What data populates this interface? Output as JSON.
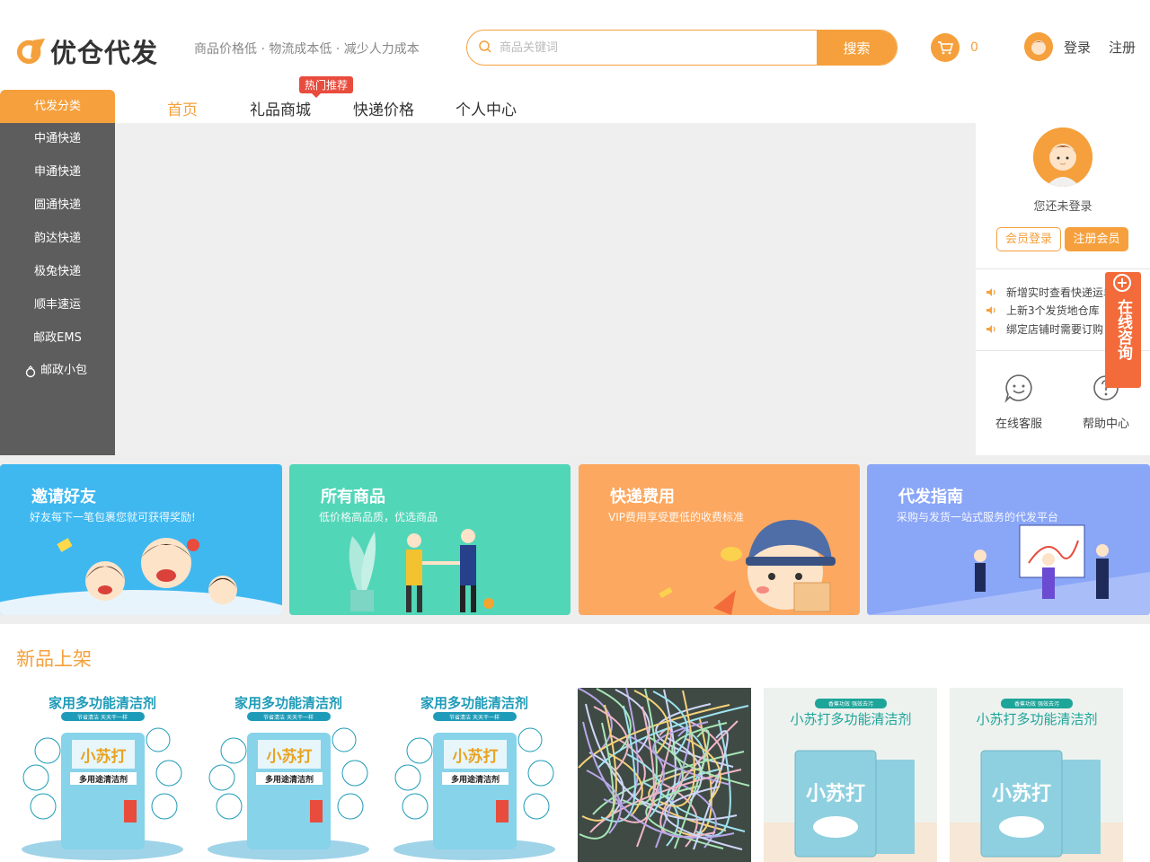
{
  "header": {
    "logo_text": "优仓代发",
    "slogan": "商品价格低 · 物流成本低 · 减少人力成本",
    "search": {
      "placeholder": "商品关键词",
      "button": "搜索"
    },
    "cart_count": "0",
    "login": "登录",
    "register": "注册"
  },
  "category": {
    "header": "代发分类",
    "items": [
      "中通快递",
      "申通快递",
      "圆通快递",
      "韵达快递",
      "极兔快递",
      "顺丰速运",
      "邮政EMS",
      "邮政小包"
    ]
  },
  "nav": {
    "items": [
      "首页",
      "礼品商城",
      "快递价格",
      "个人中心"
    ],
    "hot_badge": "热门推荐"
  },
  "user_panel": {
    "status": "您还未登录",
    "member_login": "会员登录",
    "register_member": "注册会员",
    "news": [
      "新增实时查看快递运单",
      "上新3个发货地仓库",
      "绑定店铺时需要订购"
    ],
    "services": [
      "在线客服",
      "帮助中心"
    ]
  },
  "consult": {
    "label": "在线咨询"
  },
  "cards": [
    {
      "title": "邀请好友",
      "subtitle": "好友每下一笔包裹您就可获得奖励!",
      "color": "#3fb8f0"
    },
    {
      "title": "所有商品",
      "subtitle": "低价格高品质，优选商品",
      "color": "#52d6b8"
    },
    {
      "title": "快递费用",
      "subtitle": "VIP费用享受更低的收费标准",
      "color": "#fca860"
    },
    {
      "title": "代发指南",
      "subtitle": "采购与发货一站式服务的代发平台",
      "color": "#8aa6f7"
    }
  ],
  "new_products": {
    "title": "新品上架",
    "items": [
      {
        "headline": "家用多功能清洁剂",
        "tagline": "节省清洁 天天干一样",
        "brand": "小苏打",
        "product": "多用途清洁剂"
      },
      {
        "headline": "家用多功能清洁剂",
        "tagline": "节省清洁 天天干一样",
        "brand": "小苏打",
        "product": "多用途清洁剂"
      },
      {
        "headline": "家用多功能清洁剂",
        "tagline": "节省清洁 天天干一样",
        "brand": "小苏打",
        "product": "多用途清洁剂"
      },
      {
        "headline": "",
        "tagline": "",
        "brand": "",
        "product": ""
      },
      {
        "headline": "小苏打多功能清洁剂",
        "tagline": "香蕉功效 强效去污",
        "brand": "小苏打",
        "product": ""
      },
      {
        "headline": "小苏打多功能清洁剂",
        "tagline": "香蕉功效 强效去污",
        "brand": "小苏打",
        "product": ""
      }
    ]
  },
  "colors": {
    "accent": "#f5a03c",
    "sidebar": "#5d5d5d",
    "hot": "#e84c3d",
    "consult": "#f36b3a"
  }
}
